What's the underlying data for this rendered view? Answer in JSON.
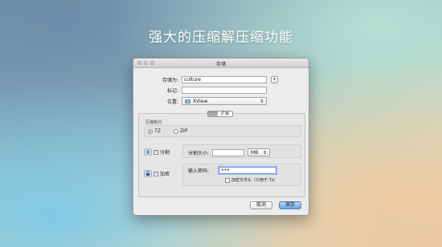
{
  "headline": "强大的压缩解压缩功能",
  "window": {
    "title": "存储"
  },
  "form": {
    "save_as_label": "存储为:",
    "save_as_value": "culture",
    "tags_label": "标记:",
    "tags_value": "",
    "location_label": "位置:",
    "location_value": "XView",
    "expand_glyph": "▾"
  },
  "tabs": {
    "basic": "",
    "extended": "扩展"
  },
  "format": {
    "group_label": "压缩格式:",
    "options": [
      "7Z",
      "ZIP"
    ],
    "selected": "7Z"
  },
  "split": {
    "label": "分割",
    "checked": true,
    "size_label": "分割大小:",
    "size_value": "",
    "unit": "MB"
  },
  "encrypt": {
    "label": "加密",
    "checked": true,
    "password_label": "输入密码:",
    "password_value": "•••",
    "encrypt_folder_label": "加密文件头（只用于 7z）",
    "encrypt_folder_checked": false
  },
  "buttons": {
    "cancel": "取消",
    "save": "保存"
  },
  "colors": {
    "primary_button": "#6fa3e3",
    "headline": "#ffffff"
  },
  "icons": {
    "split": "scissors-icon",
    "encrypt": "lock-icon",
    "folder": "folder-icon"
  }
}
